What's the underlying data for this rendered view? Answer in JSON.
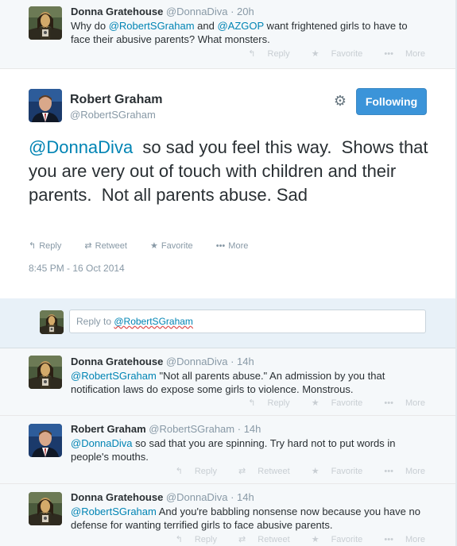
{
  "colors": {
    "link": "#0084b4",
    "follow_button": "#3b94d9",
    "muted": "#8899a6"
  },
  "top_tweet": {
    "fullname": "Donna Gratehouse",
    "screen_name": "@DonnaDiva",
    "time": "· 20h",
    "text_1": "Why do ",
    "mention_1": "@RobertSGraham",
    "text_2": " and ",
    "mention_2": "@AZGOP",
    "text_3": " want frightened girls to have to face their abusive parents? What monsters.",
    "actions": {
      "reply": "Reply",
      "favorite": "Favorite",
      "more": "More"
    }
  },
  "main_tweet": {
    "fullname": "Robert Graham",
    "screen_name": "@RobertSGraham",
    "follow_label": "Following",
    "settings_icon": "gear-icon",
    "mention": "@DonnaDiva",
    "text": "  so sad you feel this way.  Shows that you are very out of touch with children and their parents.  Not all parents abuse. Sad",
    "actions": {
      "reply": "Reply",
      "retweet": "Retweet",
      "favorite": "Favorite",
      "more": "More"
    },
    "timestamp": "8:45 PM - 16 Oct 2014"
  },
  "reply_box": {
    "prefix": "Reply to ",
    "target": "@RobertSGraham"
  },
  "replies": [
    {
      "fullname": "Donna Gratehouse",
      "screen_name": "@DonnaDiva",
      "time": "· 14h",
      "mention": "@RobertSGraham",
      "text": " \"Not all parents abuse.\" An admission by you that notification laws do expose some girls to violence. Monstrous.",
      "actions": {
        "reply": "Reply",
        "favorite": "Favorite",
        "more": "More"
      }
    },
    {
      "fullname": "Robert Graham",
      "screen_name": "@RobertSGraham",
      "time": "· 14h",
      "mention": "@DonnaDiva",
      "text": " so sad that you are spinning. Try hard not to put words in people's mouths.",
      "actions": {
        "reply": "Reply",
        "retweet": "Retweet",
        "favorite": "Favorite",
        "more": "More"
      }
    },
    {
      "fullname": "Donna Gratehouse",
      "screen_name": "@DonnaDiva",
      "time": "· 14h",
      "mention": "@RobertSGraham",
      "text": " And you're babbling nonsense now because you have no defense for wanting terrified girls to face abusive parents.",
      "actions": {
        "reply": "Reply",
        "retweet": "Retweet",
        "favorite": "Favorite",
        "more": "More"
      }
    }
  ]
}
